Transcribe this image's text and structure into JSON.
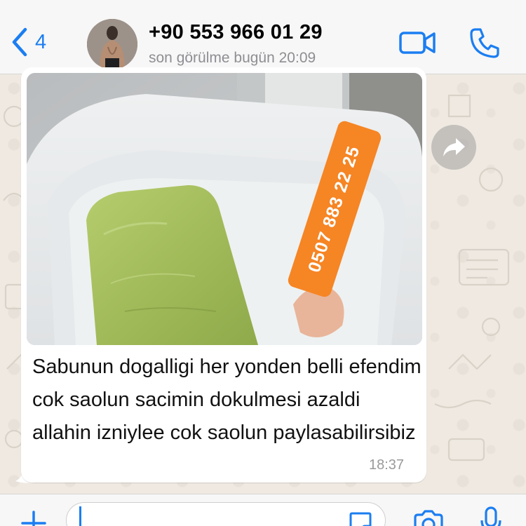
{
  "header": {
    "back_count": "4",
    "contact_name": "+90 553 966 01 29",
    "last_seen": "son görülme bugün 20:09"
  },
  "message": {
    "image_overlay_text": "0507 883 22 25",
    "text": "Sabunun dogalligi her yonden belli efendim cok saolun sacimin dokulmesi azaldi allahin izniylee cok saolun paylasabilirsibiz",
    "time": "18:37"
  },
  "input": {
    "value": ""
  },
  "icons": {
    "back": "chevron-left-icon",
    "video": "video-camera-icon",
    "call": "phone-icon",
    "forward": "forward-arrow-icon",
    "plus": "plus-icon",
    "sticker": "sticker-icon",
    "camera": "camera-icon",
    "mic": "microphone-icon"
  },
  "colors": {
    "accent": "#1b7ef2",
    "phone_tag": "#f68524",
    "bubble": "#ffffff",
    "wallpaper": "#efe9e1"
  }
}
